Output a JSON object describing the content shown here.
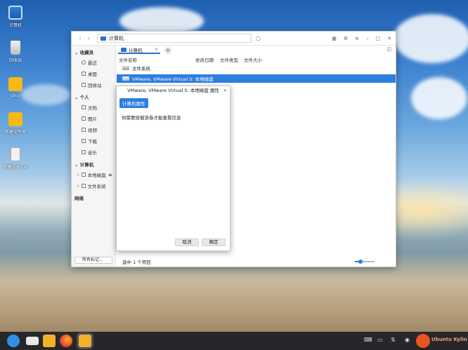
{
  "desktop": {
    "icons": [
      {
        "label": "计算机",
        "icon": "computer-icon"
      },
      {
        "label": "回收站",
        "icon": "trash-icon"
      },
      {
        "label": "ubuy",
        "icon": "home-folder-icon"
      },
      {
        "label": "新建文件夹",
        "icon": "folder-icon"
      },
      {
        "label": "新建文本.txt",
        "icon": "text-file-icon"
      }
    ]
  },
  "file_manager": {
    "address": "计算机",
    "tab_label": "计算机",
    "sidebar": {
      "favorites_header": "收藏夹",
      "favorites": [
        "最近",
        "桌面",
        "回收站"
      ],
      "personal_header": "个人",
      "personal": [
        "文档",
        "图片",
        "视频",
        "下载",
        "音乐"
      ],
      "computer_header": "计算机",
      "computer": [
        "本地磁盘",
        "文件系统"
      ],
      "network_header": "网络",
      "all_tags": "所有标记..."
    },
    "columns": [
      "文件名称",
      "修改日期",
      "文件类型",
      "文件大小"
    ],
    "rows": [
      {
        "name": "文件系统",
        "selected": false
      },
      {
        "name": "VMware, VMware Virtual S: 本地磁盘",
        "selected": true
      }
    ],
    "status": "选中 1 个项目",
    "zoom_level": 0.3
  },
  "dialog": {
    "title": "VMware, VMware Virtual S: 本地磁盘 属性",
    "tab": "计算机属性",
    "message": "你需要挂载该卷才能查看信息",
    "cancel": "取消",
    "ok": "确定"
  },
  "taskbar": {
    "watermark": "Ubuntu Kylin"
  },
  "colors": {
    "accent": "#2e7ee0",
    "taskbar": "#1c2026"
  }
}
